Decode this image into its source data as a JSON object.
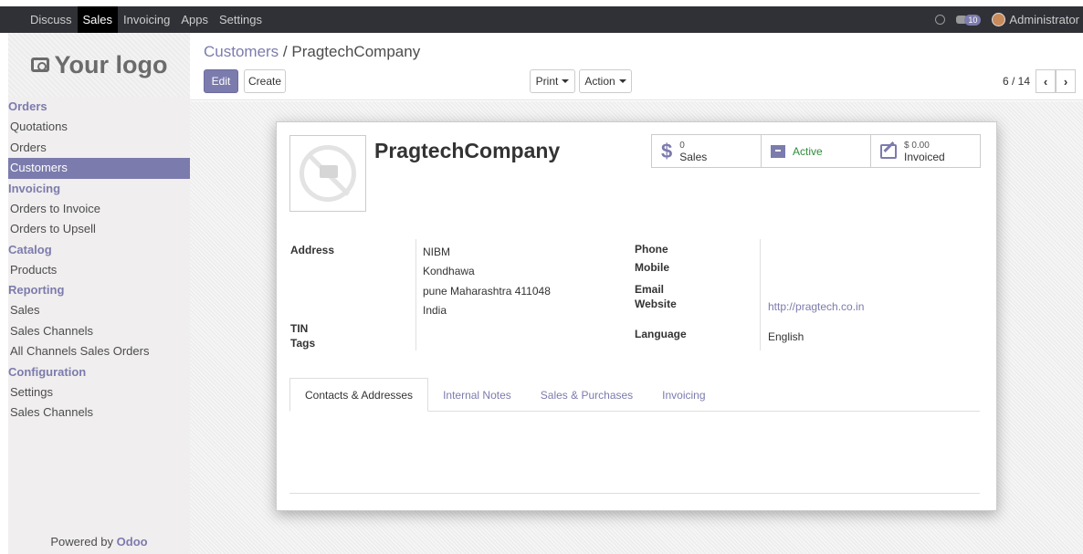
{
  "topbar": {
    "menu": [
      "Discuss",
      "Sales",
      "Invoicing",
      "Apps",
      "Settings"
    ],
    "active": "Sales",
    "chat_count": "10",
    "user": "Administrator"
  },
  "sidebar": {
    "logo": "Your logo",
    "groups": [
      {
        "title": "Orders",
        "items": [
          "Quotations",
          "Orders",
          "Customers"
        ]
      },
      {
        "title": "Invoicing",
        "items": [
          "Orders to Invoice",
          "Orders to Upsell"
        ]
      },
      {
        "title": "Catalog",
        "items": [
          "Products"
        ]
      },
      {
        "title": "Reporting",
        "items": [
          "Sales",
          "Sales Channels",
          "All Channels Sales Orders"
        ]
      },
      {
        "title": "Configuration",
        "items": [
          "Settings",
          "Sales Channels"
        ]
      }
    ],
    "active_item": "Customers",
    "powered_by": "Powered by",
    "powered_brand": "Odoo"
  },
  "control": {
    "breadcrumb_parent": "Customers",
    "breadcrumb_sep": "/",
    "breadcrumb_current": "PragtechCompany",
    "edit_label": "Edit",
    "create_label": "Create",
    "print_label": "Print",
    "action_label": "Action",
    "pager": "6 / 14"
  },
  "form": {
    "name": "PragtechCompany",
    "stats": {
      "sales_count": "0",
      "sales_label": "Sales",
      "active_label": "Active",
      "invoiced_amount": "$ 0.00",
      "invoiced_label": "Invoiced"
    },
    "labels": {
      "address": "Address",
      "tin": "TIN",
      "tags": "Tags",
      "phone": "Phone",
      "mobile": "Mobile",
      "email": "Email",
      "website": "Website",
      "language": "Language"
    },
    "address_lines": [
      "NIBM",
      "Kondhawa",
      "pune Maharashtra 411048",
      "India"
    ],
    "website": "http://pragtech.co.in",
    "language": "English",
    "tabs": [
      "Contacts & Addresses",
      "Internal Notes",
      "Sales & Purchases",
      "Invoicing"
    ],
    "active_tab": "Contacts & Addresses"
  },
  "colors": {
    "brand": "#7c7bad",
    "topbar": "#2f3136",
    "active_green": "#2e8c3c"
  }
}
